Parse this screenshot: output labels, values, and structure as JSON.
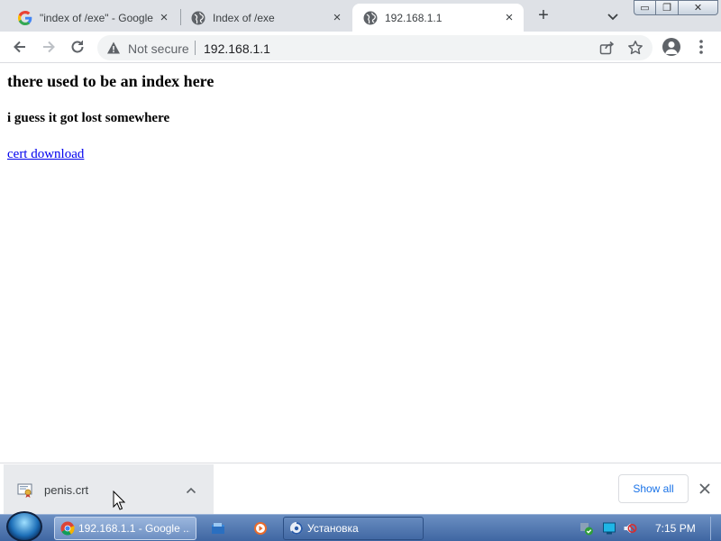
{
  "browser": {
    "tabs": [
      {
        "label": "\"index of /exe\" - Google Search",
        "icon": "google-g-icon",
        "active": false
      },
      {
        "label": "Index of /exe",
        "icon": "globe-icon",
        "active": false
      },
      {
        "label": "192.168.1.1",
        "icon": "globe-icon",
        "active": true
      }
    ],
    "new_tab_symbol": "+",
    "close_symbol": "×",
    "window_controls": {
      "minimize": "▭",
      "maximize": "❐",
      "close": "✕"
    },
    "omnibox": {
      "security_label": "Not secure",
      "url": "192.168.1.1"
    }
  },
  "page": {
    "heading": "there used to be an index here",
    "subheading": "i guess it got lost somewhere",
    "link": "cert download"
  },
  "downloads": {
    "filename": "penis.crt",
    "show_all_label": "Show all"
  },
  "taskbar": {
    "tasks": [
      {
        "label": "192.168.1.1 - Google ...",
        "icon": "chrome-icon",
        "active": true
      },
      {
        "label": "Установка",
        "icon": "setup-icon",
        "active": false
      }
    ],
    "clock": "7:15 PM"
  },
  "colors": {
    "tabstrip_bg": "#dee1e6",
    "link": "#0000ee",
    "accent": "#1a73e8",
    "taskbar_top": "#6b8fc2",
    "taskbar_bottom": "#3f66a2"
  }
}
